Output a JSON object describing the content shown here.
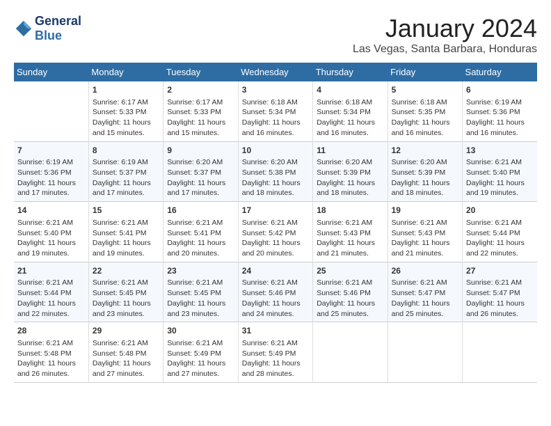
{
  "header": {
    "logo_line1": "General",
    "logo_line2": "Blue",
    "month": "January 2024",
    "location": "Las Vegas, Santa Barbara, Honduras"
  },
  "days_of_week": [
    "Sunday",
    "Monday",
    "Tuesday",
    "Wednesday",
    "Thursday",
    "Friday",
    "Saturday"
  ],
  "weeks": [
    [
      {
        "day": "",
        "info": ""
      },
      {
        "day": "1",
        "info": "Sunrise: 6:17 AM\nSunset: 5:33 PM\nDaylight: 11 hours\nand 15 minutes."
      },
      {
        "day": "2",
        "info": "Sunrise: 6:17 AM\nSunset: 5:33 PM\nDaylight: 11 hours\nand 15 minutes."
      },
      {
        "day": "3",
        "info": "Sunrise: 6:18 AM\nSunset: 5:34 PM\nDaylight: 11 hours\nand 16 minutes."
      },
      {
        "day": "4",
        "info": "Sunrise: 6:18 AM\nSunset: 5:34 PM\nDaylight: 11 hours\nand 16 minutes."
      },
      {
        "day": "5",
        "info": "Sunrise: 6:18 AM\nSunset: 5:35 PM\nDaylight: 11 hours\nand 16 minutes."
      },
      {
        "day": "6",
        "info": "Sunrise: 6:19 AM\nSunset: 5:36 PM\nDaylight: 11 hours\nand 16 minutes."
      }
    ],
    [
      {
        "day": "7",
        "info": "Sunrise: 6:19 AM\nSunset: 5:36 PM\nDaylight: 11 hours\nand 17 minutes."
      },
      {
        "day": "8",
        "info": "Sunrise: 6:19 AM\nSunset: 5:37 PM\nDaylight: 11 hours\nand 17 minutes."
      },
      {
        "day": "9",
        "info": "Sunrise: 6:20 AM\nSunset: 5:37 PM\nDaylight: 11 hours\nand 17 minutes."
      },
      {
        "day": "10",
        "info": "Sunrise: 6:20 AM\nSunset: 5:38 PM\nDaylight: 11 hours\nand 18 minutes."
      },
      {
        "day": "11",
        "info": "Sunrise: 6:20 AM\nSunset: 5:39 PM\nDaylight: 11 hours\nand 18 minutes."
      },
      {
        "day": "12",
        "info": "Sunrise: 6:20 AM\nSunset: 5:39 PM\nDaylight: 11 hours\nand 18 minutes."
      },
      {
        "day": "13",
        "info": "Sunrise: 6:21 AM\nSunset: 5:40 PM\nDaylight: 11 hours\nand 19 minutes."
      }
    ],
    [
      {
        "day": "14",
        "info": "Sunrise: 6:21 AM\nSunset: 5:40 PM\nDaylight: 11 hours\nand 19 minutes."
      },
      {
        "day": "15",
        "info": "Sunrise: 6:21 AM\nSunset: 5:41 PM\nDaylight: 11 hours\nand 19 minutes."
      },
      {
        "day": "16",
        "info": "Sunrise: 6:21 AM\nSunset: 5:41 PM\nDaylight: 11 hours\nand 20 minutes."
      },
      {
        "day": "17",
        "info": "Sunrise: 6:21 AM\nSunset: 5:42 PM\nDaylight: 11 hours\nand 20 minutes."
      },
      {
        "day": "18",
        "info": "Sunrise: 6:21 AM\nSunset: 5:43 PM\nDaylight: 11 hours\nand 21 minutes."
      },
      {
        "day": "19",
        "info": "Sunrise: 6:21 AM\nSunset: 5:43 PM\nDaylight: 11 hours\nand 21 minutes."
      },
      {
        "day": "20",
        "info": "Sunrise: 6:21 AM\nSunset: 5:44 PM\nDaylight: 11 hours\nand 22 minutes."
      }
    ],
    [
      {
        "day": "21",
        "info": "Sunrise: 6:21 AM\nSunset: 5:44 PM\nDaylight: 11 hours\nand 22 minutes."
      },
      {
        "day": "22",
        "info": "Sunrise: 6:21 AM\nSunset: 5:45 PM\nDaylight: 11 hours\nand 23 minutes."
      },
      {
        "day": "23",
        "info": "Sunrise: 6:21 AM\nSunset: 5:45 PM\nDaylight: 11 hours\nand 23 minutes."
      },
      {
        "day": "24",
        "info": "Sunrise: 6:21 AM\nSunset: 5:46 PM\nDaylight: 11 hours\nand 24 minutes."
      },
      {
        "day": "25",
        "info": "Sunrise: 6:21 AM\nSunset: 5:46 PM\nDaylight: 11 hours\nand 25 minutes."
      },
      {
        "day": "26",
        "info": "Sunrise: 6:21 AM\nSunset: 5:47 PM\nDaylight: 11 hours\nand 25 minutes."
      },
      {
        "day": "27",
        "info": "Sunrise: 6:21 AM\nSunset: 5:47 PM\nDaylight: 11 hours\nand 26 minutes."
      }
    ],
    [
      {
        "day": "28",
        "info": "Sunrise: 6:21 AM\nSunset: 5:48 PM\nDaylight: 11 hours\nand 26 minutes."
      },
      {
        "day": "29",
        "info": "Sunrise: 6:21 AM\nSunset: 5:48 PM\nDaylight: 11 hours\nand 27 minutes."
      },
      {
        "day": "30",
        "info": "Sunrise: 6:21 AM\nSunset: 5:49 PM\nDaylight: 11 hours\nand 27 minutes."
      },
      {
        "day": "31",
        "info": "Sunrise: 6:21 AM\nSunset: 5:49 PM\nDaylight: 11 hours\nand 28 minutes."
      },
      {
        "day": "",
        "info": ""
      },
      {
        "day": "",
        "info": ""
      },
      {
        "day": "",
        "info": ""
      }
    ]
  ]
}
